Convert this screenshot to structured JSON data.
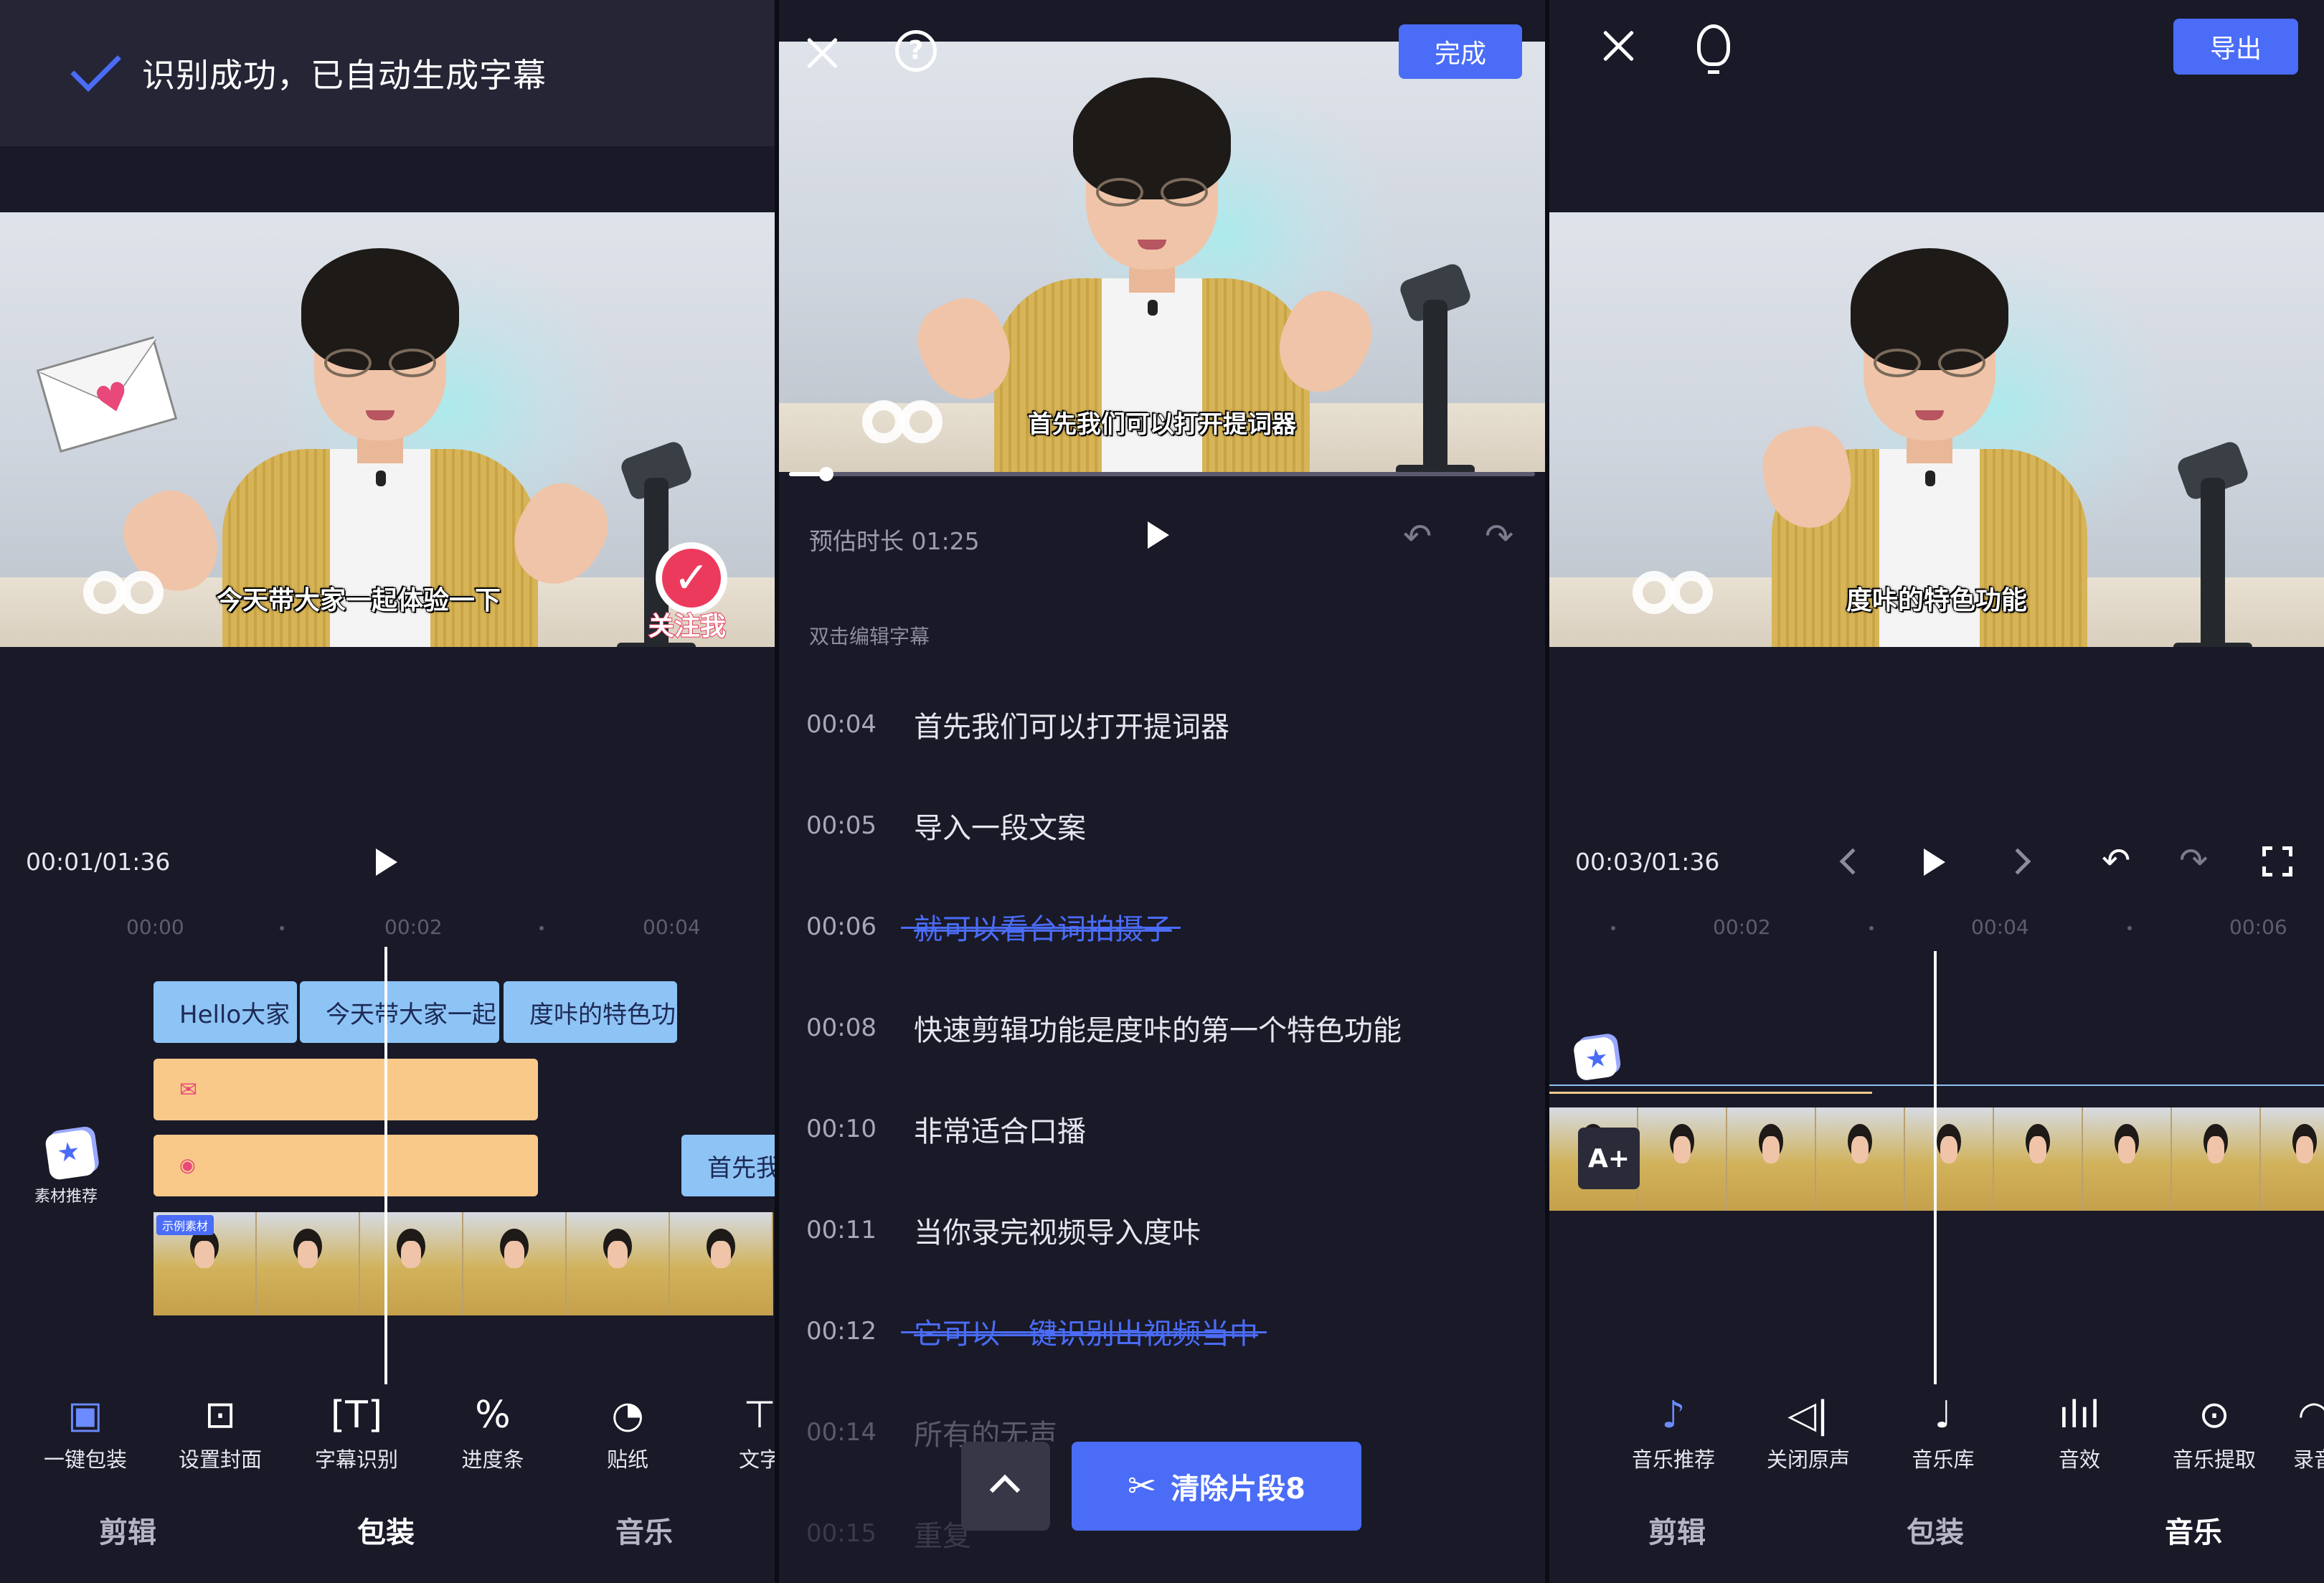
{
  "panel1": {
    "toast": "识别成功，已自动生成字幕",
    "subtitle": "今天带大家一起体验一下",
    "follow_label": "关注我",
    "timecode": "00:01/01:36",
    "ruler": [
      "00:00",
      "00:02",
      "00:04"
    ],
    "text_clips": [
      "Hello大家",
      "今天带大家一起",
      "度咔的特色功"
    ],
    "right_clip": "首先我",
    "clip_badge": "示例素材",
    "asset_label": "素材推荐",
    "tools": [
      "一键包装",
      "设置封面",
      "字幕识别",
      "进度条",
      "贴纸",
      "文字"
    ],
    "tabs": [
      "剪辑",
      "包装",
      "音乐"
    ],
    "active_tab": "包装"
  },
  "panel2": {
    "done_button": "完成",
    "subtitle": "首先我们可以打开提词器",
    "estimated": "预估时长 01:25",
    "progress": 0.05,
    "hint": "双击编辑字幕",
    "rows": [
      {
        "time": "00:04",
        "text": "首先我们可以打开提词器"
      },
      {
        "time": "00:05",
        "text": "导入一段文案"
      },
      {
        "time": "00:06",
        "text": "就可以看台词拍摄子"
      },
      {
        "time": "00:08",
        "text": "快速剪辑功能是度咔的第一个特色功能"
      },
      {
        "time": "00:10",
        "text": "非常适合口播"
      },
      {
        "time": "00:11",
        "text": "当你录完视频导入度咔"
      },
      {
        "time": "00:12",
        "text": "它可以一键识别出视频当中"
      },
      {
        "time": "00:14",
        "text": "所有的无声"
      },
      {
        "time": "00:15",
        "text": "重复"
      }
    ],
    "deleted_rows": [
      2,
      6
    ],
    "clear_button": "清除片段8"
  },
  "panel3": {
    "export_button": "导出",
    "subtitle": "度咔的特色功能",
    "timecode": "00:03/01:36",
    "ruler": [
      "00:02",
      "00:04",
      "00:06"
    ],
    "text_add_label": "A+",
    "tools": [
      "音乐推荐",
      "关闭原声",
      "音乐库",
      "音效",
      "音乐提取",
      "录音"
    ],
    "tabs": [
      "剪辑",
      "包装",
      "音乐"
    ],
    "active_tab": "音乐"
  },
  "colors": {
    "background": "#191928",
    "accent": "#4a6cf7",
    "text_clip": "#8ec3f5",
    "sticker_clip": "#f9c98a"
  }
}
